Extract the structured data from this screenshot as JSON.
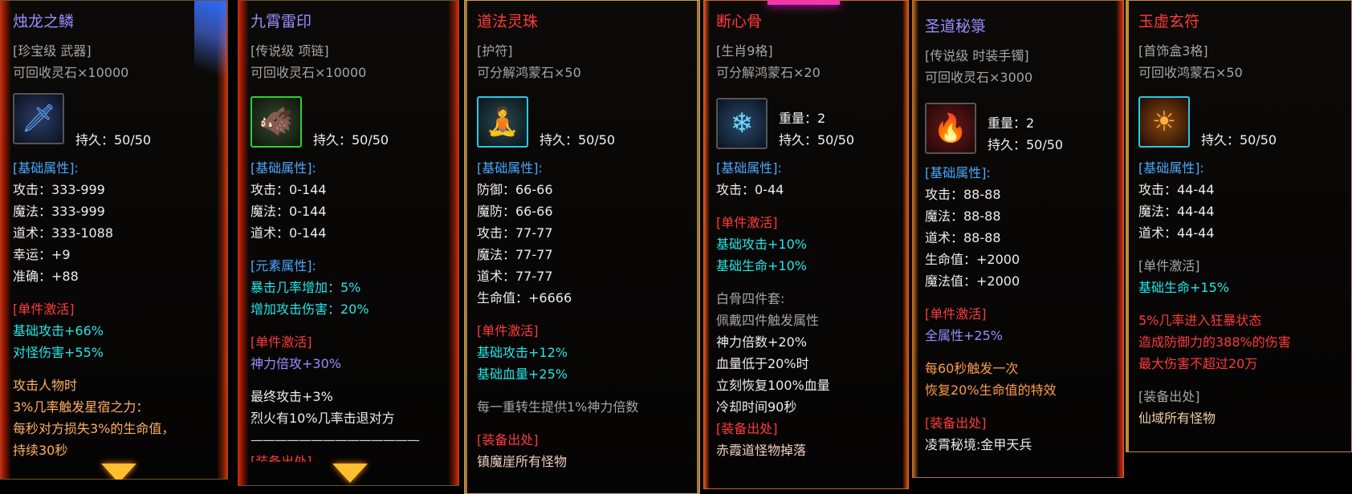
{
  "cards": [
    {
      "title": "烛龙之鳞",
      "type": "[珍宝级 武器]",
      "recycle": "可回收灵石×10000",
      "icon_name": "blue-crystal-sword-icon",
      "durability": "持久：50/50",
      "basic_header": "[基础属性]:",
      "basic": [
        "攻击：333-999",
        "魔法：333-999",
        "道术：333-1088",
        "幸运：+9",
        "准确：+88"
      ],
      "single_header": "[单件激活]",
      "single": [
        "基础攻击+66%",
        "对怪伤害+55%"
      ],
      "desc": [
        "攻击人物时",
        "3%几率触发星宿之力：",
        "每秒对方损失3%的生命值，",
        "持续30秒"
      ]
    },
    {
      "title": "九霄雷印",
      "type": "[传说级 项链]",
      "recycle": "可回收灵石×10000",
      "icon_name": "beast-seal-icon",
      "durability": "持久：50/50",
      "basic_header": "[基础属性]:",
      "basic": [
        "攻击：0-144",
        "魔法：0-144",
        "道术：0-144"
      ],
      "element_header": "[元素属性]:",
      "element": [
        "暴击几率增加：5%",
        "增加攻击伤害：20%"
      ],
      "single_header": "[单件激活]",
      "single": [
        "神力倍攻+30%"
      ],
      "desc": [
        "最终攻击+3%",
        "烈火有10%几率击退对方"
      ],
      "divider": "——————————————",
      "source_partial": "[装备出处]"
    },
    {
      "title": "道法灵珠",
      "type": "[护符]",
      "recycle": "可分解鸿蒙石×50",
      "icon_name": "spirit-orb-icon",
      "durability": "持久：50/50",
      "basic_header": "[基础属性]:",
      "basic": [
        "防御：66-66",
        "魔防：66-66",
        "攻击：77-77",
        "魔法：77-77",
        "道术：77-77",
        "生命值：+6666"
      ],
      "single_header": "[单件激活]",
      "single": [
        "基础攻击+12%",
        "基础血量+25%"
      ],
      "note": "每一重转生提供1%神力倍数",
      "source_header": "[装备出处]",
      "source": "镇魔崖所有怪物"
    },
    {
      "title": "断心骨",
      "type": "[生肖9格]",
      "recycle": "可分解鸿蒙石×20",
      "icon_name": "ice-bone-icon",
      "weight": "重量：2",
      "durability": "持久：50/50",
      "basic_header": "[基础属性]:",
      "basic": [
        "攻击：0-44"
      ],
      "single_header": "[单件激活]",
      "single": [
        "基础攻击+10%",
        "基础生命+10%"
      ],
      "set_header": "白骨四件套:",
      "set_sub": "佩戴四件触发属性",
      "set": [
        "神力倍数+20%",
        "血量低于20%时",
        "立刻恢复100%血量",
        "冷却时间90秒"
      ],
      "source_header": "[装备出处]",
      "source": "赤霞道怪物掉落"
    },
    {
      "title": "圣道秘箓",
      "type": "[传说级 时装手镯]",
      "recycle": "可回收灵石×3000",
      "icon_name": "red-bracer-icon",
      "weight": "重量：2",
      "durability": "持久：50/50",
      "basic_header": "[基础属性]:",
      "basic": [
        "攻击：88-88",
        "魔法：88-88",
        "道术：88-88",
        "生命值：+2000",
        "魔法值：+2000"
      ],
      "single_header": "[单件激活]",
      "single": [
        "全属性+25%"
      ],
      "effect": [
        "每60秒触发一次",
        "恢复20%生命值的特效"
      ],
      "source_header": "[装备出处]",
      "source": "凌霄秘境:金甲天兵"
    },
    {
      "title": "玉虚玄符",
      "type": "[首饰盒3格]",
      "recycle": "可回收鸿蒙石×50",
      "icon_name": "golden-mask-icon",
      "durability": "持久：50/50",
      "basic_header": "[基础属性]:",
      "basic": [
        "攻击：44-44",
        "魔法：44-44",
        "道术：44-44"
      ],
      "single_header": "[单件激活]",
      "single": [
        "基础生命+15%"
      ],
      "effect": [
        "5%几率进入狂暴状态",
        "造成防御力的388%的伤害",
        "最大伤害不超过20万"
      ],
      "source_header": "[装备出处]",
      "source": "仙域所有怪物"
    }
  ],
  "colors": {
    "title_purple": "#9a8cff",
    "title_red": "#ff3a3a",
    "header_blue": "#4aa8ff",
    "single_red": "#ff3a3a",
    "bonus_cyan": "#22e6e6",
    "desc_orange": "#ffb060"
  }
}
